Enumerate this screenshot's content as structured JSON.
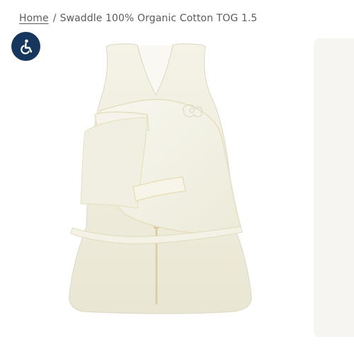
{
  "breadcrumb": {
    "home_label": "Home",
    "separator": "/",
    "current": "Swaddle 100% Organic Cotton TOG 1.5"
  },
  "accessibility": {
    "icon": "accessibility-icon",
    "bg_color": "#17365d"
  },
  "product": {
    "image_icon": "sleep-sack-swaddle-image",
    "fabric_color": "#f3f1e4"
  }
}
